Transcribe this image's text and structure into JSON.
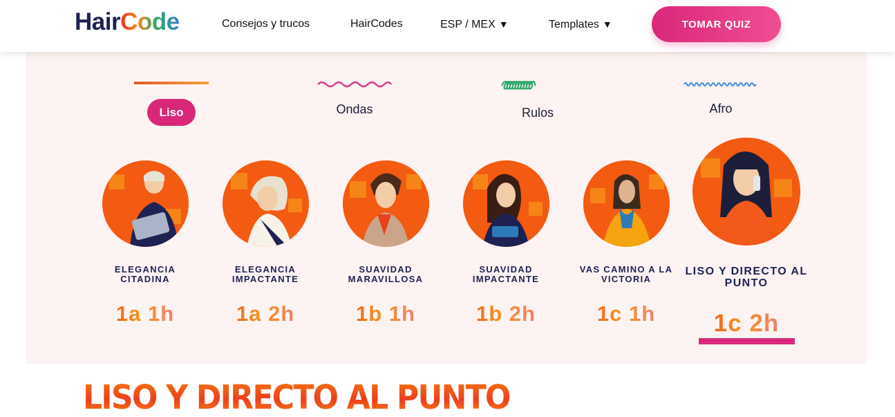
{
  "header": {
    "logo_part1": "Hair",
    "logo_part2": "Code",
    "nav": {
      "tips": "Consejos y trucos",
      "haircodes": "HairCodes",
      "locale": "ESP / MEX",
      "templates": "Templates"
    },
    "caret": "▼",
    "quiz_button": "TOMAR QUIZ"
  },
  "hair_types": [
    {
      "label": "Liso",
      "active": true
    },
    {
      "label": "Ondas",
      "active": false
    },
    {
      "label": "Rulos",
      "active": false
    },
    {
      "label": "Afro",
      "active": false
    }
  ],
  "styles": [
    {
      "title_line1": "ELEGANCIA",
      "title_line2": "CITADINA",
      "code": "1a 1h",
      "active": false
    },
    {
      "title_line1": "ELEGANCIA",
      "title_line2": "IMPACTANTE",
      "code": "1a 2h",
      "active": false
    },
    {
      "title_line1": "SUAVIDAD",
      "title_line2": "MARAVILLOSA",
      "code": "1b 1h",
      "active": false
    },
    {
      "title_line1": "SUAVIDAD",
      "title_line2": "IMPACTANTE",
      "code": "1b 2h",
      "active": false
    },
    {
      "title_line1": "VAS CAMINO A LA",
      "title_line2": "VICTORIA",
      "code": "1c 1h",
      "active": false
    },
    {
      "title_line1": "LISO Y DIRECTO AL",
      "title_line2": "PUNTO",
      "code": "1c 2h",
      "active": true
    }
  ],
  "section_heading": "LISO Y DIRECTO AL PUNTO",
  "colors": {
    "brand_navy": "#1d2252",
    "accent_pink": "#d9287a",
    "panel_bg": "#fdf3f2",
    "avatar_orange": "#f35a12"
  }
}
